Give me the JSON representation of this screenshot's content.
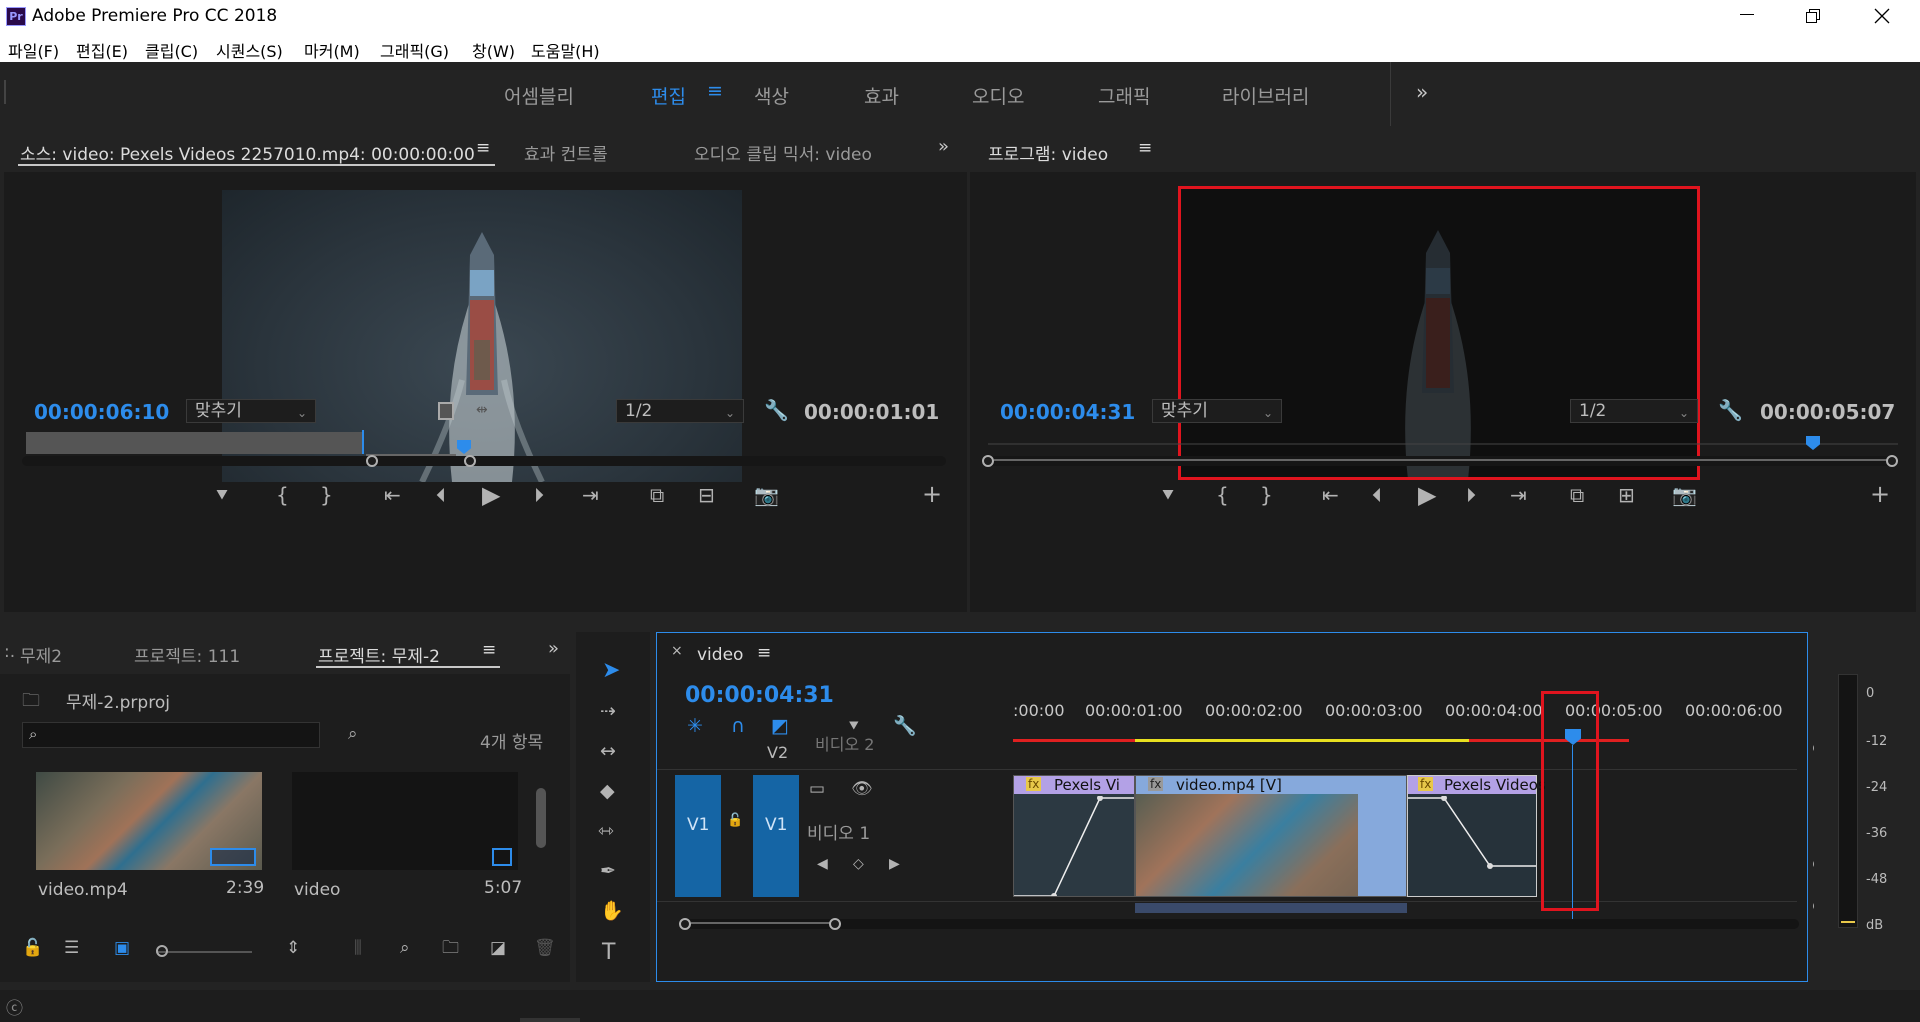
{
  "app": {
    "title": "Adobe Premiere Pro CC 2018",
    "icon_text": "Pr"
  },
  "menu": [
    "파일(F)",
    "편집(E)",
    "클립(C)",
    "시퀀스(S)",
    "마커(M)",
    "그래픽(G)",
    "창(W)",
    "도움말(H)"
  ],
  "workspaces": [
    "어셈블리",
    "편집",
    "색상",
    "효과",
    "오디오",
    "그래픽",
    "라이브러리"
  ],
  "workspace_menu": "≡",
  "source_panel": {
    "tabs": [
      "소스: video: Pexels Videos 2257010.mp4: 00:00:00:00",
      "효과 컨트롤",
      "오디오 클립 믹서: video"
    ],
    "menu": "≡",
    "timecode": "00:00:06:10",
    "fit": "맞추기",
    "resolution": "1/2",
    "duration": "00:00:01:01"
  },
  "program_panel": {
    "title": "프로그램: video",
    "menu": "≡",
    "timecode": "00:00:04:31",
    "fit": "맞추기",
    "resolution": "1/2",
    "duration": "00:00:05:07"
  },
  "project_panel": {
    "tabs": [
      "무제2",
      "프로젝트: 111",
      "프로젝트: 무제-2"
    ],
    "tab_prefix": ":.",
    "menu": "≡",
    "file": "무제-2.prproj",
    "count": "4개 항목",
    "items": [
      {
        "name": "video.mp4",
        "duration": "2:39"
      },
      {
        "name": "video",
        "duration": "5:07"
      }
    ]
  },
  "timeline": {
    "tab": "video",
    "close": "×",
    "menu": "≡",
    "timecode": "00:00:04:31",
    "ruler": [
      ":00:00",
      "00:00:01:00",
      "00:00:02:00",
      "00:00:03:00",
      "00:00:04:00",
      "00:00:05:00",
      "00:00:06:00"
    ],
    "tracks": {
      "v2": "V2",
      "v2_name": "비디오 2",
      "v1_src": "V1",
      "v1": "V1",
      "v1_name": "비디오 1"
    },
    "clips": [
      "Pexels Vi",
      "video.mp4 [V]",
      "Pexels Videos"
    ],
    "fx": "fx"
  },
  "meter": {
    "labels": [
      "0",
      "-12",
      "-24",
      "-36",
      "-48",
      "dB"
    ]
  },
  "colors": {
    "accent": "#2d8ceb",
    "highlight_box": "#e0141e",
    "track_blue": "#1565a5",
    "clip_purple": "#b3a1e6",
    "clip_lightblue": "#86a9dc"
  }
}
